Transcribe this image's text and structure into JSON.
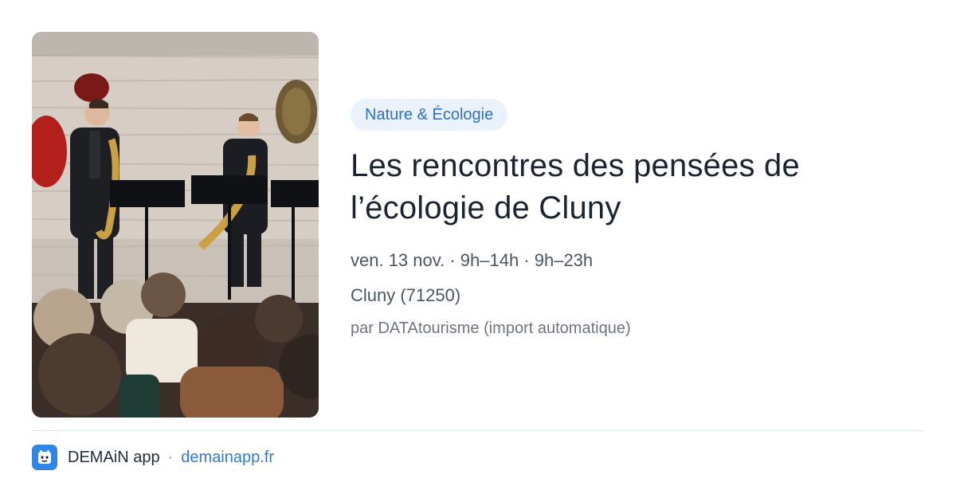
{
  "event": {
    "category_tag": "Nature & Écologie",
    "title": "Les rencontres des pensées de l’écologie de Cluny",
    "datetime": "ven. 13 nov. · 9h–14h · 9h–23h",
    "location": "Cluny (71250)",
    "source": "par DATAtourisme (import automatique)"
  },
  "footer": {
    "app_name": "DEMAiN app",
    "separator": "·",
    "app_url": "demainapp.fr"
  },
  "colors": {
    "tag_background": "#e9f2fd",
    "tag_text": "#2f6fc4",
    "link": "#2f7ad6",
    "app_icon": "#2f86e6"
  },
  "icons": {
    "app_icon": "demain-app-icon"
  }
}
